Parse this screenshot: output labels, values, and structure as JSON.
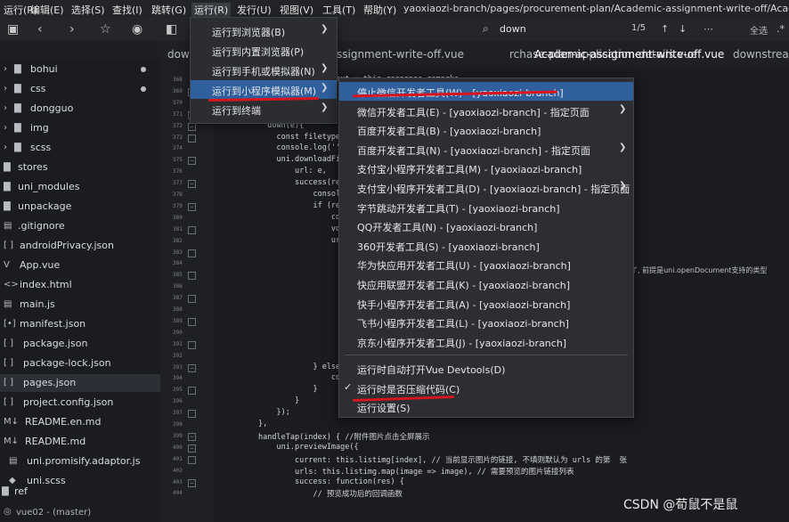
{
  "menubar": {
    "items": [
      "运行(R)",
      "编辑(E)",
      "选择(S)",
      "查找(I)",
      "跳转(G)",
      "运行(R)",
      "发行(U)",
      "视图(V)",
      "工具(T)",
      "帮助(Y)"
    ],
    "path": "yaoxiaozi-branch/pages/procurement-plan/Academic-assignment-write-off/Academic-s"
  },
  "toolbar": {
    "search_text": "down",
    "match_count": "1/5",
    "replace_label": "全选"
  },
  "sidebar": {
    "items": [
      {
        "label": "bohui",
        "type": "folder",
        "icon": "chevron-right-icon"
      },
      {
        "label": "css",
        "type": "folder",
        "icon": "chevron-right-icon"
      },
      {
        "label": "dongguo",
        "type": "folder",
        "icon": "chevron-right-icon"
      },
      {
        "label": "img",
        "type": "folder",
        "icon": "chevron-right-icon"
      },
      {
        "label": "scss",
        "type": "folder",
        "icon": "chevron-right-icon"
      },
      {
        "label": "stores",
        "type": "folder",
        "icon": "folder-icon"
      },
      {
        "label": "uni_modules",
        "type": "folder",
        "icon": "folder-icon"
      },
      {
        "label": "unpackage",
        "type": "folder",
        "icon": "folder-icon"
      },
      {
        "label": ".gitignore",
        "type": "file",
        "icon": "file-icon"
      },
      {
        "label": "androidPrivacy.json",
        "type": "file",
        "icon": "json-icon"
      },
      {
        "label": "App.vue",
        "type": "file",
        "icon": "vue-icon"
      },
      {
        "label": "index.html",
        "type": "file",
        "icon": "html-icon"
      },
      {
        "label": "main.js",
        "type": "file",
        "icon": "js-icon"
      },
      {
        "label": "manifest.json",
        "type": "file",
        "icon": "json-icon"
      },
      {
        "label": "package.json",
        "type": "file",
        "icon": "json-icon"
      },
      {
        "label": "package-lock.json",
        "type": "file",
        "icon": "json-icon"
      },
      {
        "label": "pages.json",
        "type": "file",
        "icon": "json-icon"
      },
      {
        "label": "project.config.json",
        "type": "file",
        "icon": "json-icon"
      },
      {
        "label": "README.en.md",
        "type": "file",
        "icon": "markdown-icon"
      },
      {
        "label": "README.md",
        "type": "file",
        "icon": "markdown-icon"
      },
      {
        "label": "uni.promisify.adaptor.js",
        "type": "file",
        "icon": "js-icon"
      },
      {
        "label": "uni.scss",
        "type": "file",
        "icon": "file-icon"
      },
      {
        "label": "ref",
        "type": "folder",
        "icon": "folder-icon"
      }
    ],
    "status": "vue02 - (master)"
  },
  "tabs": [
    {
      "label": "dowr"
    },
    {
      "label": "ssignment-write-off.vue"
    },
    {
      "label": "rchase-plan-application-details.vue"
    },
    {
      "label": "Academic-assignment-write-off.vue"
    },
    {
      "label": "downstream"
    }
  ],
  "menu_run": {
    "items": [
      {
        "label": "运行到浏览器(B)",
        "submenu": true
      },
      {
        "label": "运行到内置浏览器(P)",
        "submenu": false
      },
      {
        "label": "运行到手机或模拟器(N)",
        "submenu": true
      },
      {
        "label": "运行到小程序模拟器(M)",
        "submenu": true,
        "highlighted": true
      },
      {
        "label": "运行到终端",
        "submenu": true
      }
    ]
  },
  "menu_mini": {
    "items": [
      {
        "label": "停止微信开发者工具(W) - [yaoxiaozi-branch]",
        "submenu": false,
        "highlighted": true
      },
      {
        "label": "微信开发者工具(E) - [yaoxiaozi-branch] - 指定页面",
        "submenu": true
      },
      {
        "label": "百度开发者工具(B) - [yaoxiaozi-branch]",
        "submenu": false
      },
      {
        "label": "百度开发者工具(N) - [yaoxiaozi-branch] - 指定页面",
        "submenu": true
      },
      {
        "label": "支付宝小程序开发者工具(M) - [yaoxiaozi-branch]",
        "submenu": false
      },
      {
        "label": "支付宝小程序开发者工具(D) - [yaoxiaozi-branch] - 指定页面",
        "submenu": true
      },
      {
        "label": "字节跳动开发者工具(T) - [yaoxiaozi-branch]",
        "submenu": false
      },
      {
        "label": "QQ开发者工具(N) - [yaoxiaozi-branch]",
        "submenu": false
      },
      {
        "label": "360开发者工具(S) - [yaoxiaozi-branch]",
        "submenu": false
      },
      {
        "label": "华为快应用开发者工具(U) - [yaoxiaozi-branch]",
        "submenu": false
      },
      {
        "label": "快应用联盟开发者工具(K) - [yaoxiaozi-branch]",
        "submenu": false
      },
      {
        "label": "快手小程序开发者工具(A) - [yaoxiaozi-branch]",
        "submenu": false
      },
      {
        "label": "飞书小程序开发者工具(L) - [yaoxiaozi-branch]",
        "submenu": false
      },
      {
        "label": "京东小程序开发者工具(J) - [yaoxiaozi-branch]",
        "submenu": false
      }
    ],
    "extra_items": [
      {
        "label": "运行时自动打开Vue Devtools(D)",
        "checked": false
      },
      {
        "label": "运行时是否压缩代码(C)",
        "checked": true
      },
      {
        "label": "运行设置(S)",
        "checked": false
      }
    ]
  },
  "editor": {
    "line_numbers": [
      "368",
      "369",
      "370",
      "371",
      "372",
      "373",
      "374",
      "375",
      "376",
      "377",
      "378",
      "379",
      "380",
      "381",
      "382",
      "383",
      "384",
      "385",
      "386",
      "387",
      "388",
      "389",
      "390",
      "391",
      "392",
      "393",
      "394",
      "395",
      "396",
      "397",
      "398",
      "399",
      "400",
      "401",
      "402",
      "403",
      "404"
    ],
    "lines": [
      "                  s.innutText = this.response.remarks",
      "",
      "",
      "",
      "           down(e){",
      "             const filetype",
      "             console.log(''",
      "             uni.downloadFi",
      "                 url: e,",
      "                 success(re",
      "                     consol",
      "                     if (re",
      "                         co",
      "                         vo",
      "                         ur",
      "",
      "",
      "",
      "",
      "",
      "",
      "",
      "",
      "",
      "",
      "                     } else",
      "                         co",
      "                     }",
      "                 }",
      "             });",
      "         },",
      "         handleTap(index) { //附件图片点击全屏展示",
      "             uni.previewImage({",
      "                 current: this.listimg[index], // 当前显示图片的链接, 不填则默认为 urls 的第  张",
      "                 urls: this.listimg.map(image => image), // 需要预览的图片链接列表",
      "                 success: function(res) {",
      "                     // 预览成功后的回调函数"
    ],
    "right_note": "了, 前提是uni.openDocument支持的类型"
  },
  "watermark": "CSDN @荀鼠不是鼠",
  "colors": {
    "highlight": "#2f5f9d",
    "annotation": "#d8141c"
  }
}
